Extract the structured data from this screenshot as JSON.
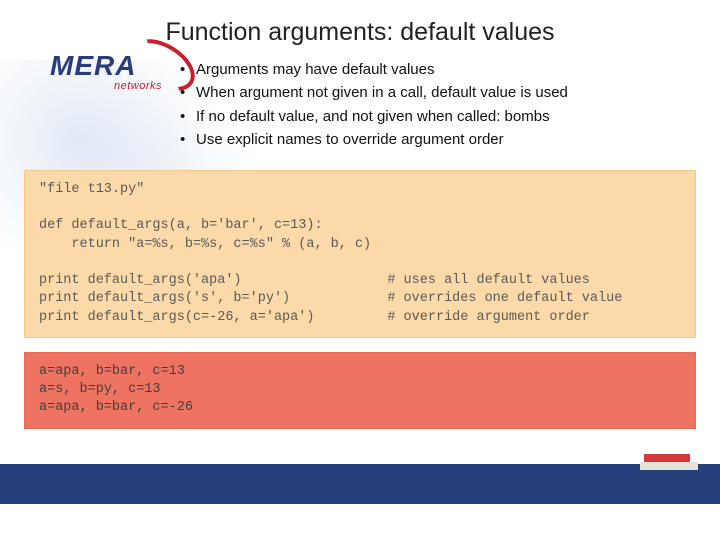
{
  "title": "Function arguments: default values",
  "logo": {
    "main": "MERA",
    "sub": "networks"
  },
  "bullets": [
    "Arguments may have default values",
    "When argument not given in a call, default value is used",
    "If no default value, and not given when called: bombs",
    "Use explicit names to override argument order"
  ],
  "code": {
    "source": "\"file t13.py\"\n\ndef default_args(a, b='bar', c=13):\n    return \"a=%s, b=%s, c=%s\" % (a, b, c)\n\nprint default_args('apa')                  # uses all default values\nprint default_args('s', b='py')            # overrides one default value\nprint default_args(c=-26, a='apa')         # override argument order",
    "output": "a=apa, b=bar, c=13\na=s, b=py, c=13\na=apa, b=bar, c=-26"
  }
}
